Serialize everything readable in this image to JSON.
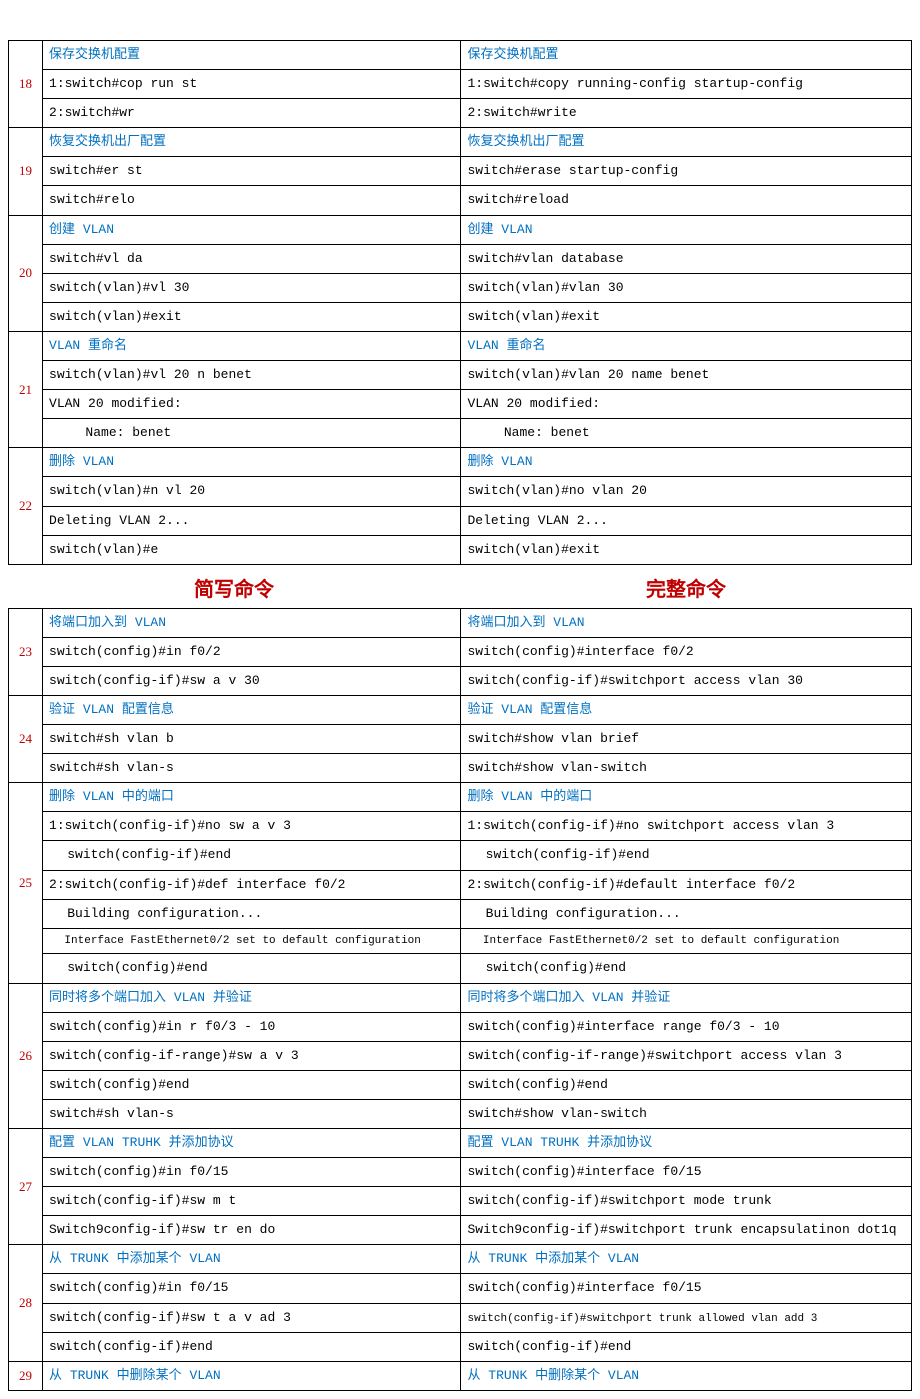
{
  "headers": {
    "short": "简写命令",
    "full": "完整命令"
  },
  "rows1": [
    {
      "num": "18",
      "left_title": "保存交换机配置",
      "right_title": "保存交换机配置",
      "left": [
        "1:switch#cop run st",
        "2:switch#wr"
      ],
      "right": [
        "1:switch#copy running-config startup-config",
        "2:switch#write"
      ]
    },
    {
      "num": "19",
      "left_title": "恢复交换机出厂配置",
      "right_title": "恢复交换机出厂配置",
      "left": [
        "switch#er st",
        "switch#relo"
      ],
      "right": [
        "switch#erase startup-config",
        "switch#reload"
      ]
    },
    {
      "num": "20",
      "left_title": "创建 VLAN",
      "right_title": "创建 VLAN",
      "left": [
        "switch#vl da",
        "switch(vlan)#vl 30",
        "switch(vlan)#exit"
      ],
      "right": [
        "switch#vlan database",
        "switch(vlan)#vlan 30",
        "switch(vlan)#exit"
      ]
    },
    {
      "num": "21",
      "left_title": "VLAN 重命名",
      "right_title": "VLAN 重命名",
      "left": [
        "switch(vlan)#vl 20 n benet",
        "VLAN 20 modified:",
        {
          "text": "Name: benet",
          "indent": 2
        }
      ],
      "right": [
        "switch(vlan)#vlan 20 name benet",
        "VLAN 20 modified:",
        {
          "text": "Name: benet",
          "indent": 2
        }
      ]
    },
    {
      "num": "22",
      "left_title": "删除 VLAN",
      "right_title": "删除 VLAN",
      "left": [
        "switch(vlan)#n vl 20",
        "Deleting VLAN 2...",
        "switch(vlan)#e"
      ],
      "right": [
        "switch(vlan)#no vlan 20",
        "Deleting VLAN 2...",
        "switch(vlan)#exit"
      ]
    }
  ],
  "rows2": [
    {
      "num": "23",
      "left_title": "将端口加入到 VLAN",
      "right_title": "将端口加入到 VLAN",
      "left": [
        "switch(config)#in f0/2",
        "switch(config-if)#sw a v 30"
      ],
      "right": [
        "switch(config)#interface f0/2",
        "switch(config-if)#switchport access vlan 30"
      ]
    },
    {
      "num": "24",
      "left_title": "验证 VLAN 配置信息",
      "right_title": "验证 VLAN 配置信息",
      "left": [
        "switch#sh vlan b",
        "switch#sh vlan-s"
      ],
      "right": [
        "switch#show vlan brief",
        "switch#show vlan-switch"
      ]
    },
    {
      "num": "25",
      "left_title": "删除 VLAN 中的端口",
      "right_title": "删除 VLAN 中的端口",
      "left": [
        "1:switch(config-if)#no sw a v 3",
        {
          "text": "switch(config-if)#end",
          "indent": 1
        },
        "2:switch(config-if)#def interface f0/2",
        {
          "text": "Building configuration...",
          "indent": 1
        },
        {
          "text": "Interface FastEthernet0/2 set to default configuration",
          "indent": 1,
          "small": true
        },
        {
          "text": "switch(config)#end",
          "indent": 1
        }
      ],
      "right": [
        "1:switch(config-if)#no switchport access vlan 3",
        {
          "text": "switch(config-if)#end",
          "indent": 1
        },
        "2:switch(config-if)#default interface f0/2",
        {
          "text": "Building configuration...",
          "indent": 1
        },
        {
          "text": "Interface FastEthernet0/2 set to default configuration",
          "indent": 1,
          "small": true
        },
        {
          "text": "switch(config)#end",
          "indent": 1
        }
      ]
    },
    {
      "num": "26",
      "left_title": "同时将多个端口加入 VLAN 并验证",
      "right_title": "同时将多个端口加入 VLAN 并验证",
      "left": [
        "switch(config)#in r f0/3 - 10",
        "switch(config-if-range)#sw a v 3",
        "switch(config)#end",
        "switch#sh vlan-s"
      ],
      "right": [
        "switch(config)#interface range f0/3 - 10",
        "switch(config-if-range)#switchport access vlan 3",
        "switch(config)#end",
        "switch#show vlan-switch"
      ]
    },
    {
      "num": "27",
      "left_title": "配置 VLAN TRUHK 并添加协议",
      "right_title": "配置 VLAN TRUHK  并添加协议",
      "left": [
        "switch(config)#in f0/15",
        "switch(config-if)#sw m t",
        "Switch9config-if)#sw tr en do"
      ],
      "right": [
        "switch(config)#interface f0/15",
        "switch(config-if)#switchport mode trunk",
        "Switch9config-if)#switchport trunk encapsulatinon dot1q"
      ]
    },
    {
      "num": "28",
      "left_title": "从 TRUNK 中添加某个 VLAN",
      "right_title": "从 TRUNK 中添加某个 VLAN",
      "left": [
        "switch(config)#in f0/15",
        "switch(config-if)#sw t a v ad 3",
        "switch(config-if)#end"
      ],
      "right": [
        "switch(config)#interface f0/15",
        {
          "text": "switch(config-if)#switchport trunk allowed vlan add 3",
          "small": true
        },
        "switch(config-if)#end"
      ]
    },
    {
      "num": "29",
      "left_title": "从 TRUNK 中删除某个 VLAN",
      "right_title": "从 TRUNK 中删除某个 VLAN",
      "left": [],
      "right": []
    }
  ]
}
